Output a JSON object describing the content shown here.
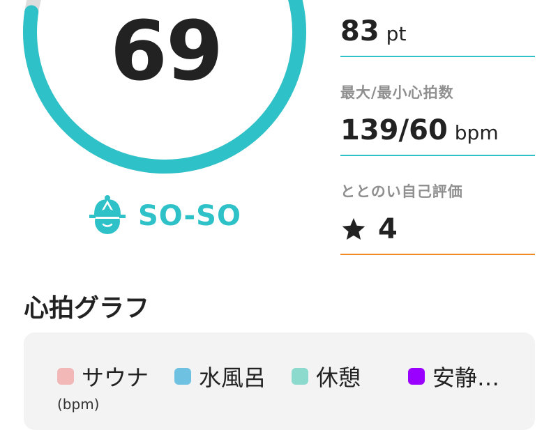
{
  "score": {
    "value": "69",
    "fraction": 0.69,
    "ring_color": "#2ec2c8",
    "track_color": "#dddddd"
  },
  "status": {
    "label": "SO-SO",
    "icon": "capped-face-icon",
    "color": "#2ec2c8"
  },
  "stats": {
    "points": {
      "value": "83",
      "unit": "pt",
      "line_color": "#2ec2c8"
    },
    "heart_rate": {
      "label": "最大/最小心拍数",
      "value": "139/60",
      "unit": "bpm",
      "line_color": "#2ec2c8"
    },
    "self_rating": {
      "label": "ととのい自己評価",
      "icon": "star-icon",
      "value": "4",
      "line_color": "#f08a24"
    }
  },
  "graph": {
    "title": "心拍グラフ",
    "legend": [
      {
        "label": "サウナ",
        "color": "#f2b8b8"
      },
      {
        "label": "水風呂",
        "color": "#6fc1e2"
      },
      {
        "label": "休憩",
        "color": "#8cd9cd"
      },
      {
        "label": "安静…",
        "color": "#9900ff"
      }
    ],
    "y_unit": "(bpm)"
  }
}
